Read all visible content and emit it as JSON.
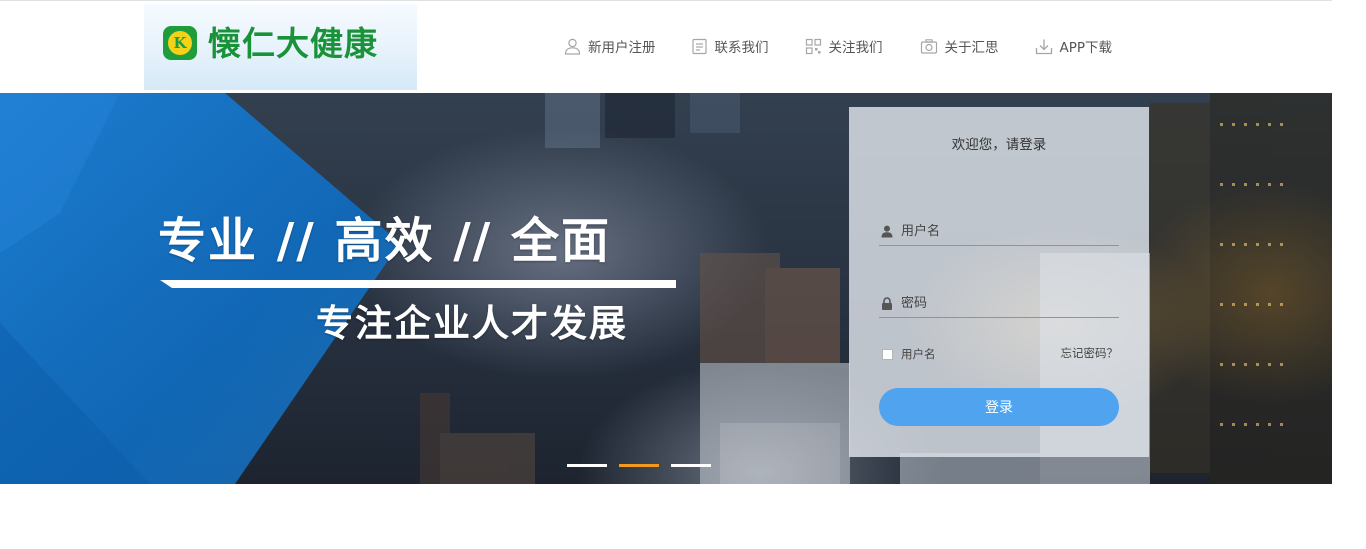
{
  "brand": {
    "logo_text": "懐仁大健康",
    "logo_mark": "K",
    "colors": {
      "logo_green": "#19923a",
      "logo_badge_yellow": "#f5d21a"
    }
  },
  "nav": {
    "items": [
      {
        "label": "新用户注册",
        "icon": "user-icon"
      },
      {
        "label": "联系我们",
        "icon": "contact-card-icon"
      },
      {
        "label": "关注我们",
        "icon": "qr-code-icon"
      },
      {
        "label": "关于汇思",
        "icon": "camera-icon"
      },
      {
        "label": "APP下载",
        "icon": "download-icon"
      }
    ]
  },
  "banner": {
    "slogan": "专业 // 高效 // 全面",
    "subslogan": "专注企业人才发展",
    "carousel": {
      "count": 3,
      "active_index": 1,
      "active_color": "#f39a1e"
    }
  },
  "login": {
    "title": "欢迎您，请登录",
    "username_placeholder": "用户名",
    "password_placeholder": "密码",
    "remember_label": "用户名",
    "forgot_label": "忘记密码？",
    "submit_label": "登录",
    "colors": {
      "button": "#4fa3ef"
    }
  }
}
